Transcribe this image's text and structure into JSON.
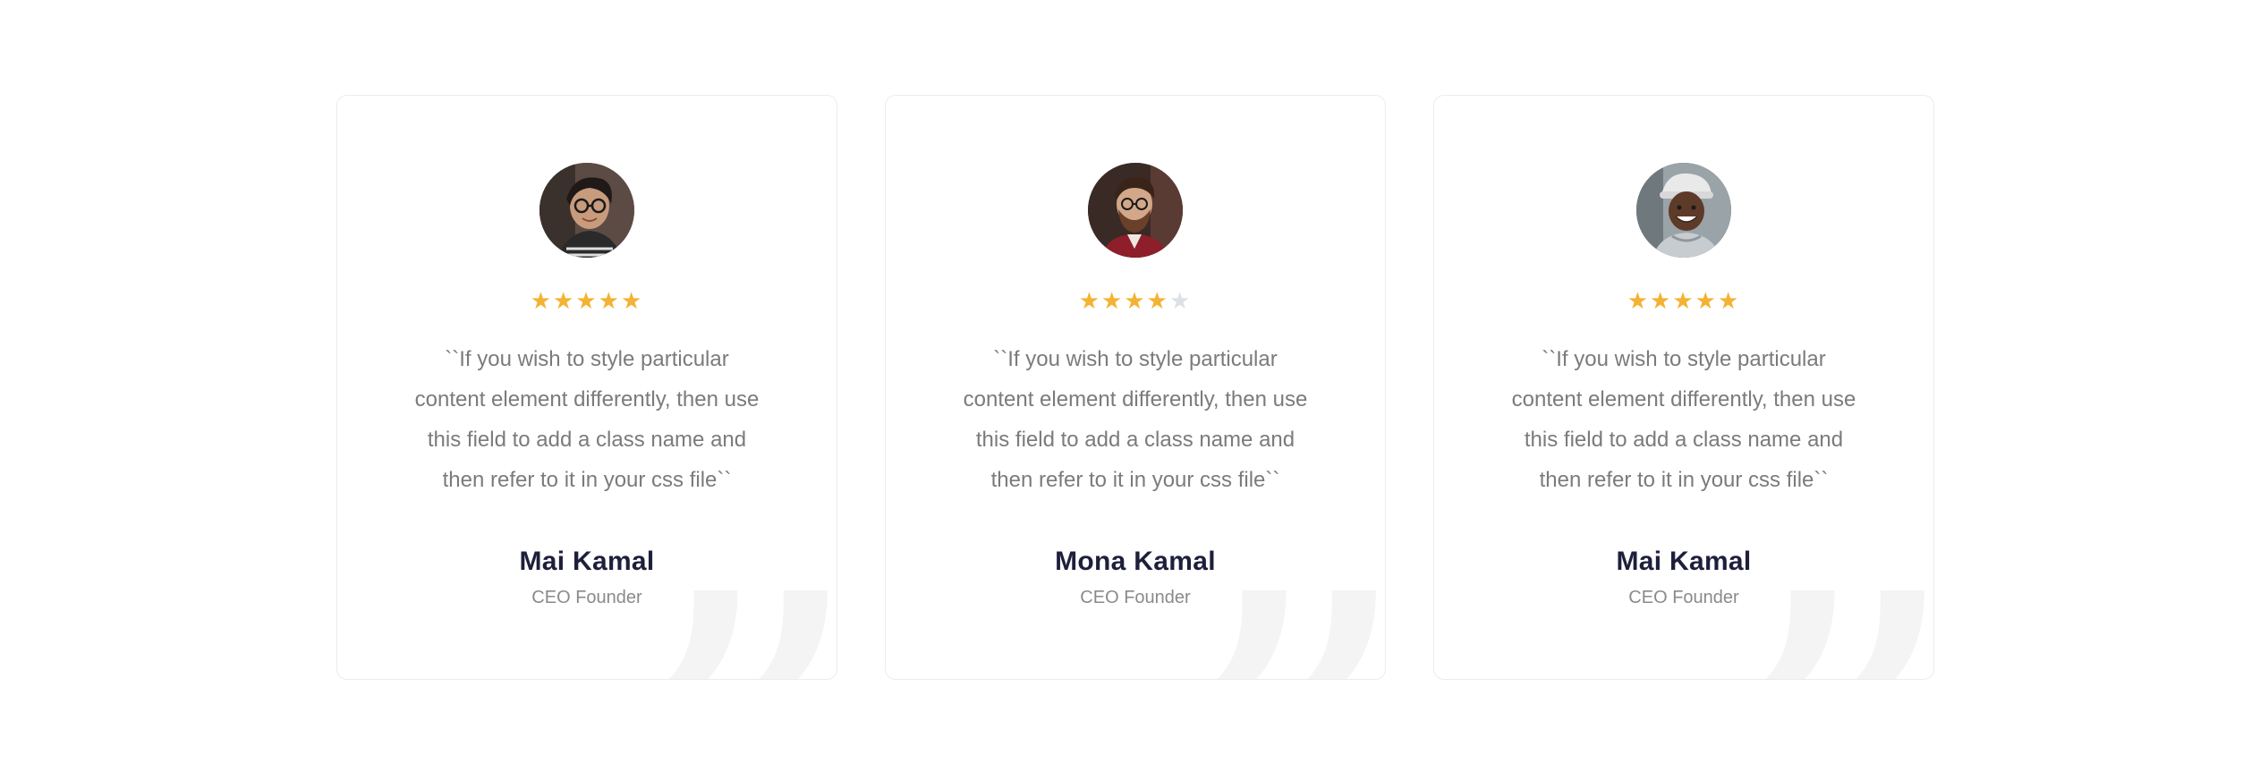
{
  "testimonials": [
    {
      "avatar_icon": "woman-with-glasses-avatar",
      "rating": 5,
      "max_rating": 5,
      "star_filled_color": "#f4b233",
      "star_empty_color": "#dde1e6",
      "quote": "``If you wish to style particular content element differently, then use this field to add a class name and then refer to it in your css file``",
      "name": "Mai Kamal",
      "role": "CEO Founder"
    },
    {
      "avatar_icon": "bearded-man-avatar",
      "rating": 4,
      "max_rating": 5,
      "star_filled_color": "#f4b233",
      "star_empty_color": "#dde1e6",
      "quote": "``If you wish to style particular content element differently, then use this field to add a class name and then refer to it in your css file``",
      "name": "Mona Kamal",
      "role": "CEO Founder"
    },
    {
      "avatar_icon": "smiling-woman-with-cap-avatar",
      "rating": 5,
      "max_rating": 5,
      "star_filled_color": "#f4b233",
      "star_empty_color": "#dde1e6",
      "quote": "``If you wish to style particular content element differently, then use this field to add a class name and then refer to it in your css file``",
      "name": "Mai Kamal",
      "role": "CEO Founder"
    }
  ]
}
